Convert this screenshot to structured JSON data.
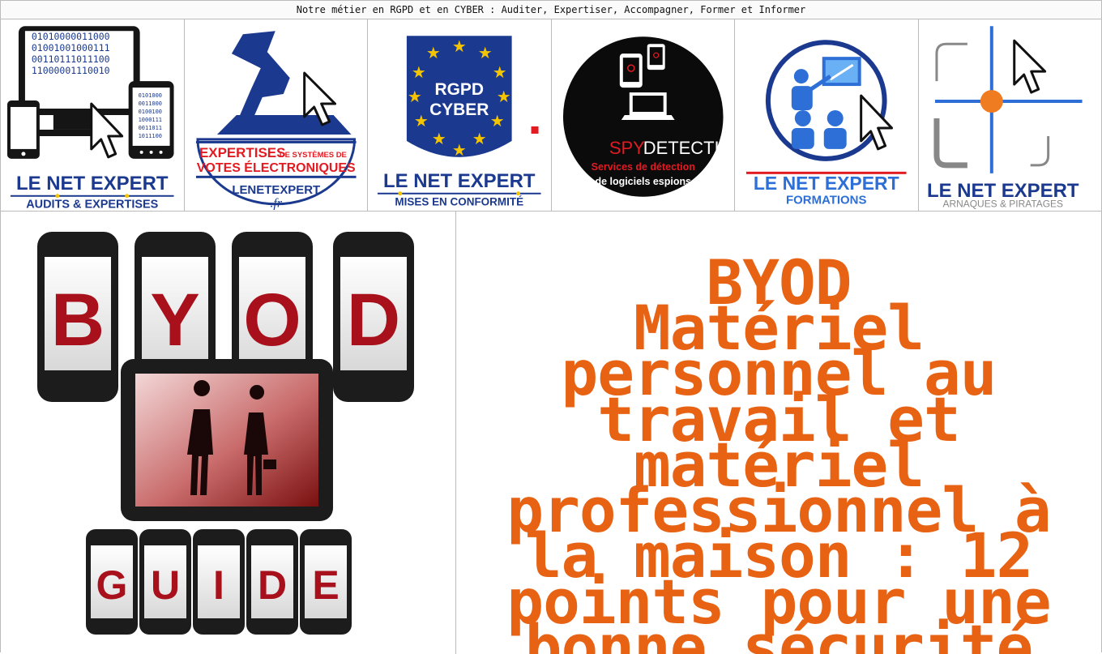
{
  "topbar": {
    "text": "Notre métier en RGPD et en CYBER : Auditer, Expertiser, Accompagner, Former et Informer"
  },
  "nav": {
    "tiles": [
      {
        "title": "LE NET EXPERT",
        "subtitle": "AUDITS & EXPERTISES",
        "binary": [
          "01010000011000",
          "01001001000111",
          "00110111011100",
          "11000001110010"
        ],
        "binary_small": [
          "0101000",
          "0011000",
          "0100100",
          "1000111",
          "0011011",
          "1011100"
        ],
        "icon": "devices-cursor-icon"
      },
      {
        "title": "EXPERTISES",
        "title_rest": "DE SYSTÈMES DE",
        "subtitle": "VOTES ÉLECTRONIQUES",
        "brand": "LENETEXPERT",
        "brand_suffix": ".fr",
        "icon": "ballot-cursor-icon"
      },
      {
        "badge_line1": "RGPD",
        "badge_line2": "CYBER",
        "title": "LE NET EXPERT",
        "subtitle": "MISES EN CONFORMITÉ",
        "icon": "eu-stars-icon"
      },
      {
        "title_a": "SPY",
        "title_b": "DETECTION",
        "line1": "Services de détection",
        "line2": "de logiciels espions",
        "icon": "spy-devices-icon"
      },
      {
        "title": "LE NET EXPERT",
        "subtitle": "FORMATIONS",
        "icon": "training-cursor-icon"
      },
      {
        "title": "LE NET EXPERT",
        "subtitle": "ARNAQUES & PIRATAGES",
        "icon": "crosshair-cursor-icon"
      }
    ]
  },
  "illustration": {
    "top_letters": [
      "B",
      "Y",
      "O",
      "D"
    ],
    "bottom_letters": [
      "G",
      "U",
      "I",
      "D",
      "E"
    ]
  },
  "headline": {
    "lines": [
      "BYOD",
      "Matériel",
      "personnel au",
      "travail et",
      "matériel",
      "professionnel à",
      "la maison : 12",
      "points pour une",
      "bonne sécurité"
    ]
  },
  "colors": {
    "orange": "#e86214",
    "navy": "#1b3a8f",
    "red": "#e21b22",
    "dark_red": "#a8101c"
  }
}
